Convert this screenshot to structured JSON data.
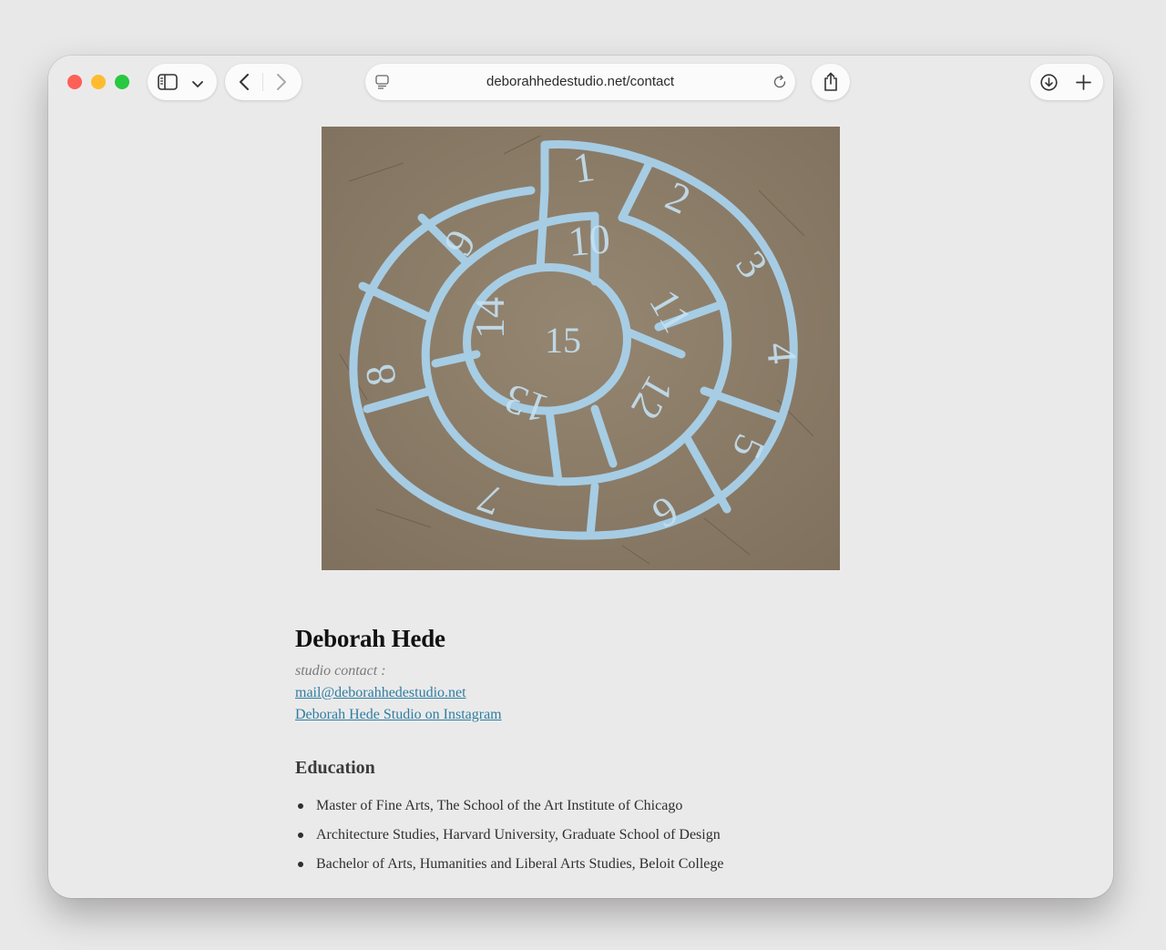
{
  "browser": {
    "url": "deborahhedestudio.net/contact"
  },
  "hero_image": {
    "alt": "Chalk spiral hopscotch drawing",
    "numbers": [
      "1",
      "2",
      "3",
      "4",
      "5",
      "6",
      "7",
      "8",
      "9",
      "10",
      "11",
      "12",
      "13",
      "14",
      "15"
    ]
  },
  "contact": {
    "name": "Deborah Hede",
    "label": "studio contact :",
    "email": "mail@deborahhedestudio.net",
    "instagram": "Deborah Hede Studio on Instagram"
  },
  "education": {
    "heading": "Education",
    "items": [
      "Master of Fine Arts, The School of the Art Institute of Chicago",
      "Architecture Studies, Harvard University, Graduate School of Design",
      "Bachelor of Arts, Humanities and Liberal Arts Studies, Beloit College"
    ]
  },
  "colors": {
    "link": "#2e7ea1",
    "chalk": "#a9d4ef",
    "pavement": "#8f7f69"
  }
}
